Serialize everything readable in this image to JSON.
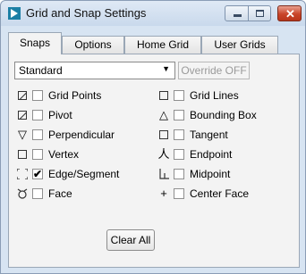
{
  "window": {
    "title": "Grid and Snap Settings",
    "close_glyph": "✕"
  },
  "tabs": [
    {
      "label": "Snaps",
      "active": true
    },
    {
      "label": "Options",
      "active": false
    },
    {
      "label": "Home Grid",
      "active": false
    },
    {
      "label": "User Grids",
      "active": false
    }
  ],
  "dropdown": {
    "value": "Standard"
  },
  "override": {
    "label": "Override OFF"
  },
  "snaps": {
    "left": [
      {
        "label": "Grid Points",
        "checked": false,
        "icon": "grid-points-icon"
      },
      {
        "label": "Pivot",
        "checked": false,
        "icon": "pivot-icon"
      },
      {
        "label": "Perpendicular",
        "checked": false,
        "icon": "perpendicular-icon"
      },
      {
        "label": "Vertex",
        "checked": false,
        "icon": "vertex-icon"
      },
      {
        "label": "Edge/Segment",
        "checked": true,
        "icon": "edge-segment-icon"
      },
      {
        "label": "Face",
        "checked": false,
        "icon": "face-icon"
      }
    ],
    "right": [
      {
        "label": "Grid Lines",
        "checked": false,
        "icon": "grid-lines-icon"
      },
      {
        "label": "Bounding Box",
        "checked": false,
        "icon": "bounding-box-icon"
      },
      {
        "label": "Tangent",
        "checked": false,
        "icon": "tangent-icon"
      },
      {
        "label": "Endpoint",
        "checked": false,
        "icon": "endpoint-icon"
      },
      {
        "label": "Midpoint",
        "checked": false,
        "icon": "midpoint-icon"
      },
      {
        "label": "Center Face",
        "checked": false,
        "icon": "center-face-icon"
      }
    ],
    "check_mark": "✔"
  },
  "clear_all": {
    "label": "Clear All"
  }
}
